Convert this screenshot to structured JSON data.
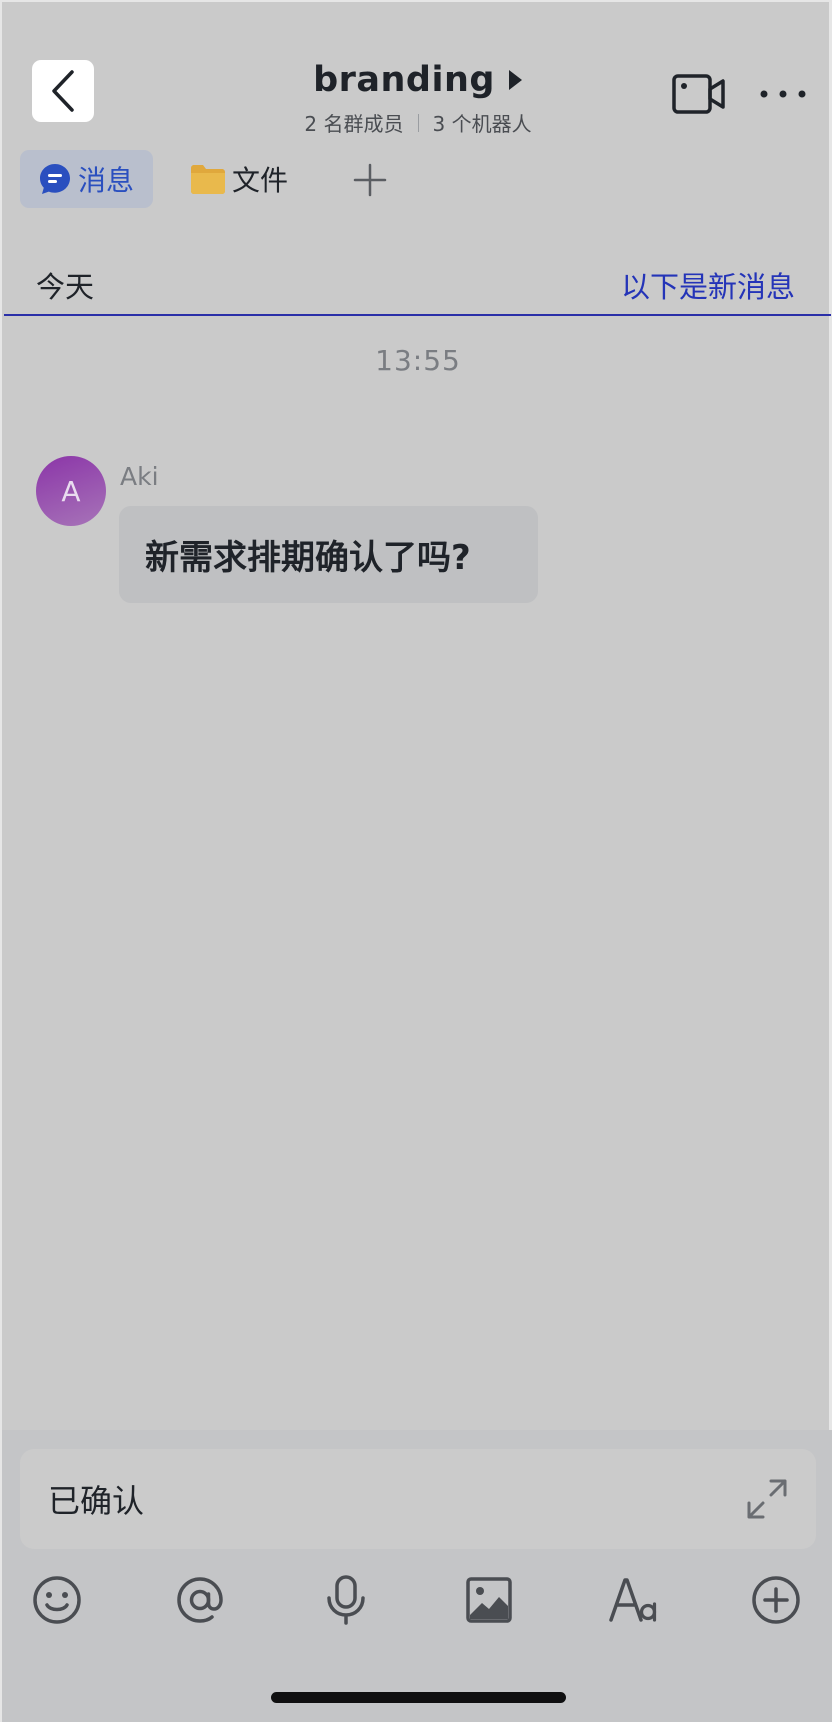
{
  "header": {
    "title": "branding",
    "members": "2 名群成员",
    "bots": "3 个机器人"
  },
  "tabs": {
    "messages": "消息",
    "files": "文件"
  },
  "divider": {
    "today": "今天",
    "new_messages": "以下是新消息"
  },
  "timestamp": "13:55",
  "message": {
    "avatar_initial": "A",
    "sender": "Aki",
    "text": "新需求排期确认了吗?"
  },
  "composer": {
    "value": "已确认"
  },
  "colors": {
    "accent": "#2434b8",
    "avatar": "#8b35a8",
    "folder": "#e0a83c"
  },
  "icons": [
    "chevron-left-icon",
    "triangle-right-icon",
    "video-camera-icon",
    "more-icon",
    "chat-bubble-icon",
    "folder-icon",
    "plus-icon",
    "expand-icon",
    "emoji-icon",
    "at-icon",
    "microphone-icon",
    "image-icon",
    "font-icon",
    "plus-circle-icon"
  ]
}
